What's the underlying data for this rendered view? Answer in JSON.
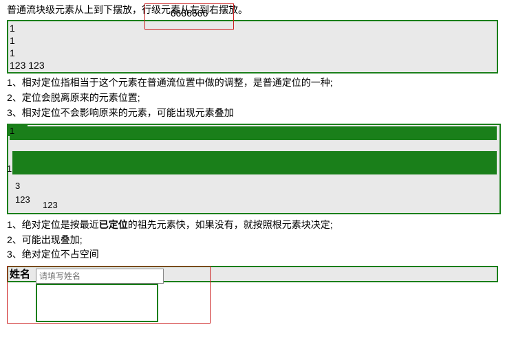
{
  "intro": "普通流块级元素从上到下摆放，行级元素从左到右摆放。",
  "float_number": "6666666",
  "demo1": {
    "r1": "1",
    "r2": "1",
    "r3": "1",
    "r4": "123 123"
  },
  "notes1": {
    "n1": "1、相对定位指相当于这个元素在普通流位置中做的调整，是普通定位的一种;",
    "n2": "2、定位会脱离原来的元素位置;",
    "n3": "3、相对定位不会影响原来的元素，可能出现元素叠加"
  },
  "demo2": {
    "a": "1",
    "b": "1",
    "c": "3",
    "d": "123",
    "e": "123"
  },
  "notes2": {
    "n1_pre": "1、绝对定位是按最近",
    "n1_bold": "已定位",
    "n1_post": "的祖先元素快，如果没有，就按照根元素块决定;",
    "n2": "2、可能出现叠加;",
    "n3": "3、绝对定位不占空间"
  },
  "form": {
    "label": "姓名",
    "placeholder": "请填写姓名"
  }
}
